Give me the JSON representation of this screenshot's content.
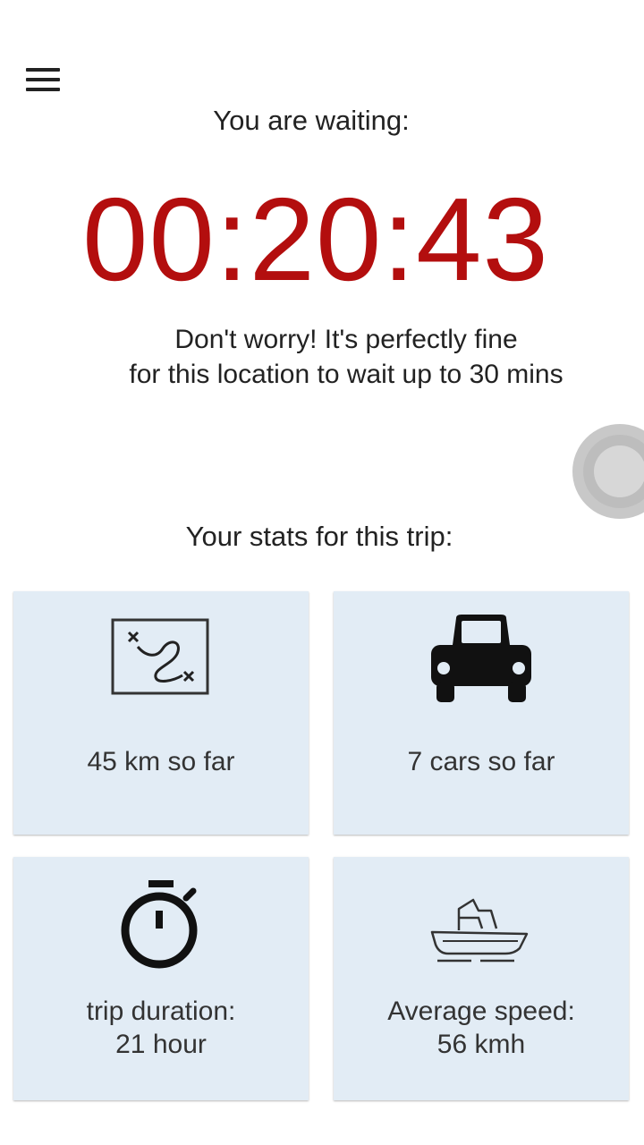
{
  "header": {
    "menu_icon": "hamburger-menu-icon"
  },
  "waiting": {
    "label": "You are waiting:",
    "timer": "00:20:43",
    "timer_color": "#b30e0e",
    "reassure_line1": "Don't worry! It's perfectly fine",
    "reassure_line2": "for this location to wait up to 30 mins"
  },
  "stats": {
    "heading": "Your stats for this trip:",
    "card_color": "#e2ecf5",
    "cards": [
      {
        "icon": "map-route-icon",
        "line1": "45 km so far",
        "line2": ""
      },
      {
        "icon": "car-icon",
        "line1": "7 cars so far",
        "line2": ""
      },
      {
        "icon": "stopwatch-icon",
        "line1": "trip duration:",
        "line2": "21 hour"
      },
      {
        "icon": "boat-icon",
        "line1": "Average speed:",
        "line2": "56 kmh"
      }
    ]
  }
}
